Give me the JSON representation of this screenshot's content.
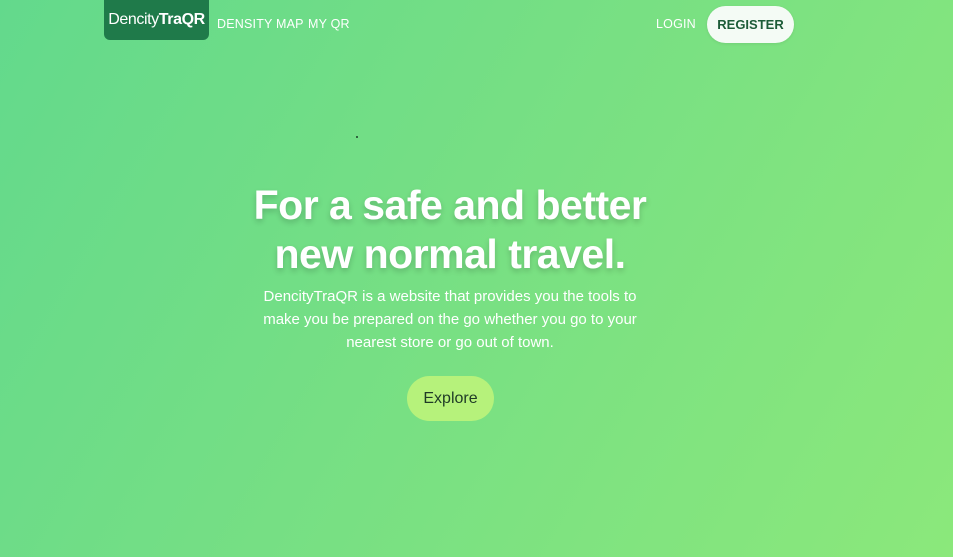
{
  "navbar": {
    "brand_light": "Dencity",
    "brand_bold": "TraQR",
    "links": [
      "DENSITY MAP",
      "MY QR"
    ],
    "login": "LOGIN",
    "register": "REGISTER"
  },
  "hero": {
    "title_line1": "For a safe and better",
    "title_line2": "new normal travel.",
    "description": "DencityTraQR is a website that provides you the tools to make you be prepared on the go whether you go to your nearest store or go out of town.",
    "cta": "Explore"
  },
  "colors": {
    "background_start": "#63d98c",
    "background_end": "#8be87b",
    "brand_bg": "#1f7a4a",
    "cta_bg": "#b6f27b",
    "register_text": "#1d5c38"
  }
}
